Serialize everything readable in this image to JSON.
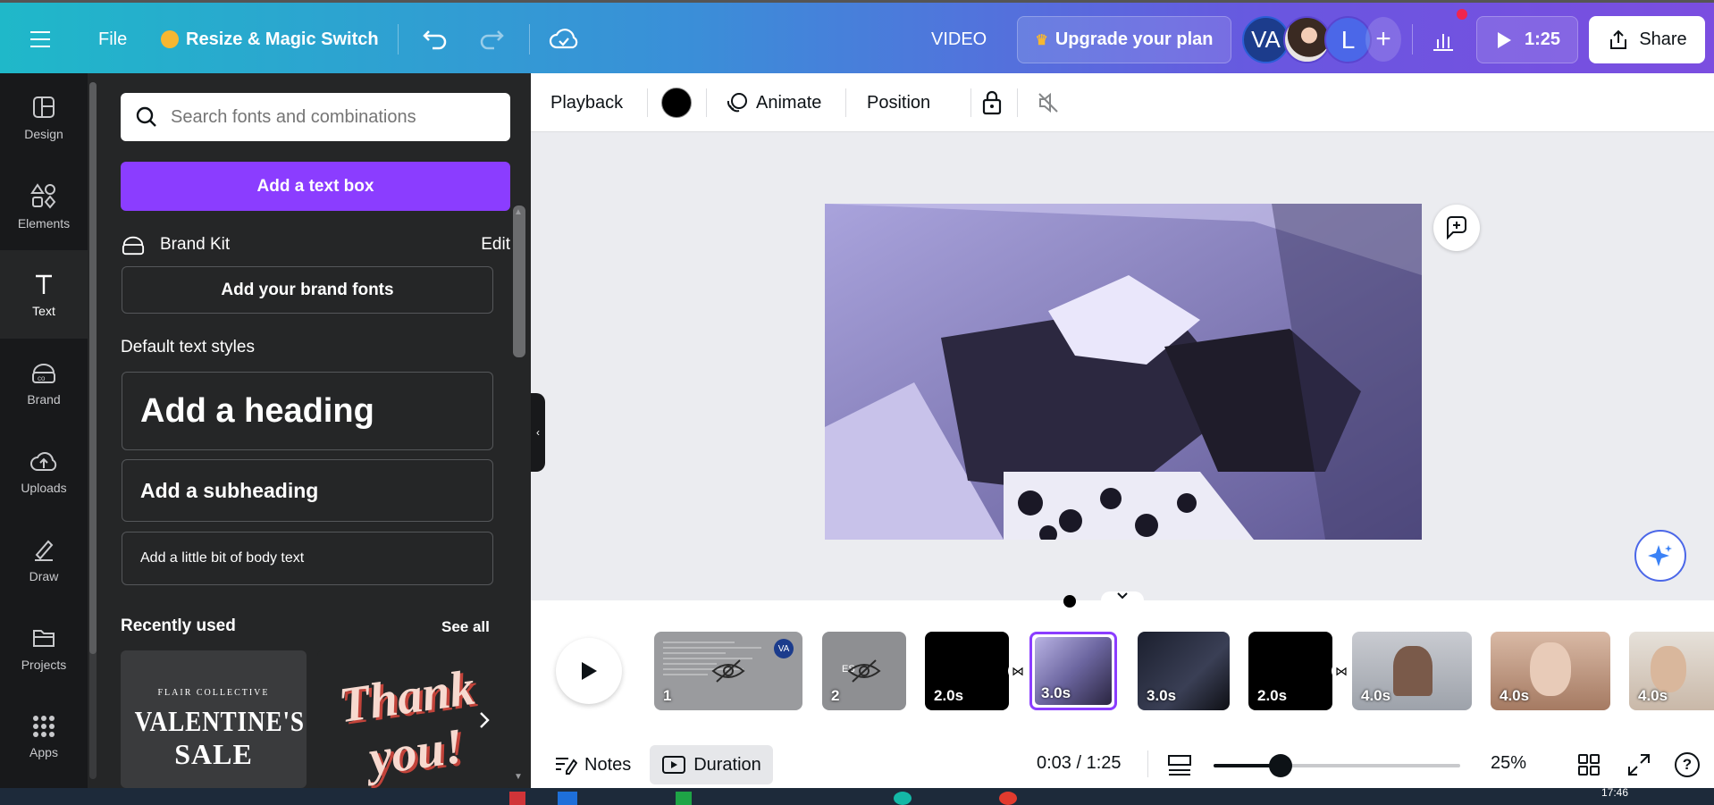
{
  "topbar": {
    "menu_icon": "hamburger-icon",
    "file_label": "File",
    "resize_label": "Resize & Magic Switch",
    "mode_label": "VIDEO",
    "upgrade_label": "Upgrade your plan",
    "avatar_initials": "VA",
    "avatar_letter": "L",
    "play_time": "1:25",
    "share_label": "Share"
  },
  "rail": {
    "items": [
      {
        "label": "Design",
        "icon": "design-icon"
      },
      {
        "label": "Elements",
        "icon": "elements-icon"
      },
      {
        "label": "Text",
        "icon": "text-icon"
      },
      {
        "label": "Brand",
        "icon": "brand-icon"
      },
      {
        "label": "Uploads",
        "icon": "uploads-icon"
      },
      {
        "label": "Draw",
        "icon": "draw-icon"
      },
      {
        "label": "Projects",
        "icon": "projects-icon"
      },
      {
        "label": "Apps",
        "icon": "apps-icon"
      }
    ]
  },
  "panel": {
    "search_placeholder": "Search fonts and combinations",
    "add_textbox": "Add a text box",
    "brand_kit": "Brand Kit",
    "edit": "Edit",
    "add_brand_fonts": "Add your brand fonts",
    "default_styles": "Default text styles",
    "heading": "Add a heading",
    "subheading": "Add a subheading",
    "body": "Add a little bit of body text",
    "recently_used": "Recently used",
    "see_all": "See all",
    "recent": [
      {
        "top": "FLAIR COLLECTIVE",
        "line1": "VALENTINE'S",
        "line2": "SALE"
      },
      {
        "line1": "Thank",
        "line2": "you!"
      }
    ]
  },
  "toolbar": {
    "playback": "Playback",
    "animate": "Animate",
    "position": "Position"
  },
  "timeline": {
    "clips": [
      {
        "label": "1",
        "badge": "VA"
      },
      {
        "label": "2",
        "text": "ES"
      },
      {
        "label": "2.0s"
      },
      {
        "label": "3.0s"
      },
      {
        "label": "3.0s"
      },
      {
        "label": "2.0s"
      },
      {
        "label": "4.0s"
      },
      {
        "label": "4.0s"
      },
      {
        "label": "4.0s"
      }
    ]
  },
  "footer": {
    "notes": "Notes",
    "duration": "Duration",
    "time": "0:03 / 1:25",
    "zoom": "25%",
    "zoom_level": 0.27,
    "clock": "17:46"
  },
  "colors": {
    "accent": "#8b3dff",
    "panel_bg": "#252627",
    "rail_bg": "#18191b"
  }
}
